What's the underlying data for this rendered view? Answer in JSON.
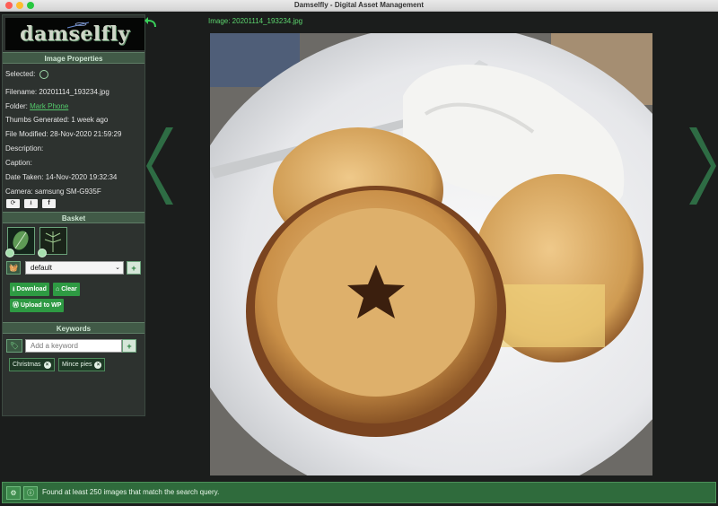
{
  "window": {
    "title": "Damselfly - Digital Asset Management"
  },
  "logo": {
    "text": "damselfly"
  },
  "image_title": "Image: 20201114_193234.jpg",
  "properties": {
    "header": "Image Properties",
    "selected_label": "Selected:",
    "filename": "Filename: 20201114_193234.jpg",
    "folder_label": "Folder:",
    "folder_link": "Mark Phone",
    "thumbs": "Thumbs Generated: 1 week ago",
    "file_modified": "File Modified: 28-Nov-2020 21:59:29",
    "description": "Description:",
    "caption": "Caption:",
    "date_taken": "Date Taken: 14-Nov-2020 19:32:34",
    "camera": "Camera: samsung SM-G935F",
    "action_icons": [
      "refresh-icon",
      "download-icon",
      "facebook-icon"
    ]
  },
  "basket": {
    "header": "Basket",
    "thumbnails": [
      "leaf-thumbnail",
      "fern-thumbnail"
    ],
    "selected_basket": "default",
    "download_label": "Download",
    "clear_label": "Clear",
    "upload_label": "Upload to WP"
  },
  "keywords": {
    "header": "Keywords",
    "placeholder": "Add a keyword",
    "tags": [
      "Christmas",
      "Mince pies"
    ]
  },
  "status": {
    "message": "Found at least 250 images that match the search query."
  },
  "colors": {
    "accent": "#2e9a43",
    "header": "#415a47",
    "status": "#2f6b3c",
    "link": "#53c96b"
  }
}
